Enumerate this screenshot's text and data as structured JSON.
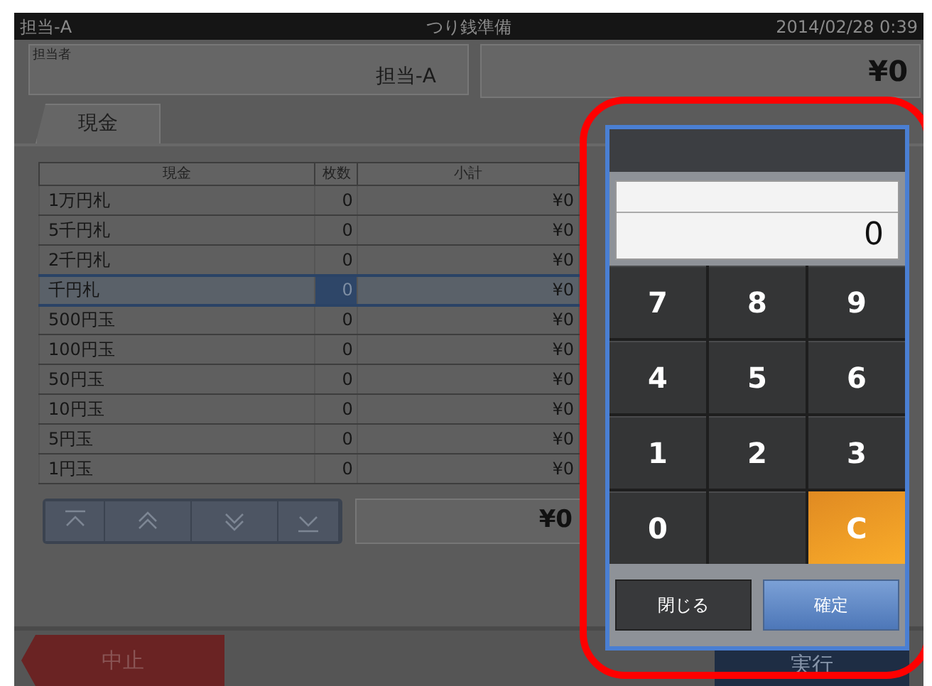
{
  "status_bar": {
    "operator": "担当-A",
    "title": "つり銭準備",
    "datetime": "2014/02/28 0:39"
  },
  "operator_field": {
    "label": "担当者",
    "value": "担当-A"
  },
  "total_display": "¥0",
  "tabs": [
    {
      "label": "現金",
      "selected": true
    }
  ],
  "table": {
    "columns": [
      "現金",
      "枚数",
      "小計"
    ],
    "rows": [
      {
        "name": "1万円札",
        "count": "0",
        "subtotal": "¥0",
        "selected": false
      },
      {
        "name": "5千円札",
        "count": "0",
        "subtotal": "¥0",
        "selected": false
      },
      {
        "name": "2千円札",
        "count": "0",
        "subtotal": "¥0",
        "selected": false
      },
      {
        "name": "千円札",
        "count": "0",
        "subtotal": "¥0",
        "selected": true
      },
      {
        "name": "500円玉",
        "count": "0",
        "subtotal": "¥0",
        "selected": false
      },
      {
        "name": "100円玉",
        "count": "0",
        "subtotal": "¥0",
        "selected": false
      },
      {
        "name": "50円玉",
        "count": "0",
        "subtotal": "¥0",
        "selected": false
      },
      {
        "name": "10円玉",
        "count": "0",
        "subtotal": "¥0",
        "selected": false
      },
      {
        "name": "5円玉",
        "count": "0",
        "subtotal": "¥0",
        "selected": false
      },
      {
        "name": "1円玉",
        "count": "0",
        "subtotal": "¥0",
        "selected": false
      }
    ]
  },
  "nav_buttons": [
    {
      "kind": "first"
    },
    {
      "kind": "prev"
    },
    {
      "kind": "next"
    },
    {
      "kind": "last"
    }
  ],
  "table_total": "¥0",
  "footer_buttons": [
    {
      "label": "中止",
      "kind": "cancel"
    },
    {
      "label": "実行",
      "kind": "execute"
    }
  ],
  "keypad": {
    "display_value": "0",
    "keys": [
      {
        "label": "7",
        "kind": "digit"
      },
      {
        "label": "8",
        "kind": "digit"
      },
      {
        "label": "9",
        "kind": "digit"
      },
      {
        "label": "4",
        "kind": "digit"
      },
      {
        "label": "5",
        "kind": "digit"
      },
      {
        "label": "6",
        "kind": "digit"
      },
      {
        "label": "1",
        "kind": "digit"
      },
      {
        "label": "2",
        "kind": "digit"
      },
      {
        "label": "3",
        "kind": "digit"
      },
      {
        "label": "0",
        "kind": "digit"
      },
      {
        "kind": "blank"
      },
      {
        "label": "C",
        "kind": "clear"
      }
    ],
    "actions": [
      {
        "label": "閉じる",
        "kind": "close"
      },
      {
        "label": "確定",
        "kind": "confirm"
      }
    ]
  }
}
